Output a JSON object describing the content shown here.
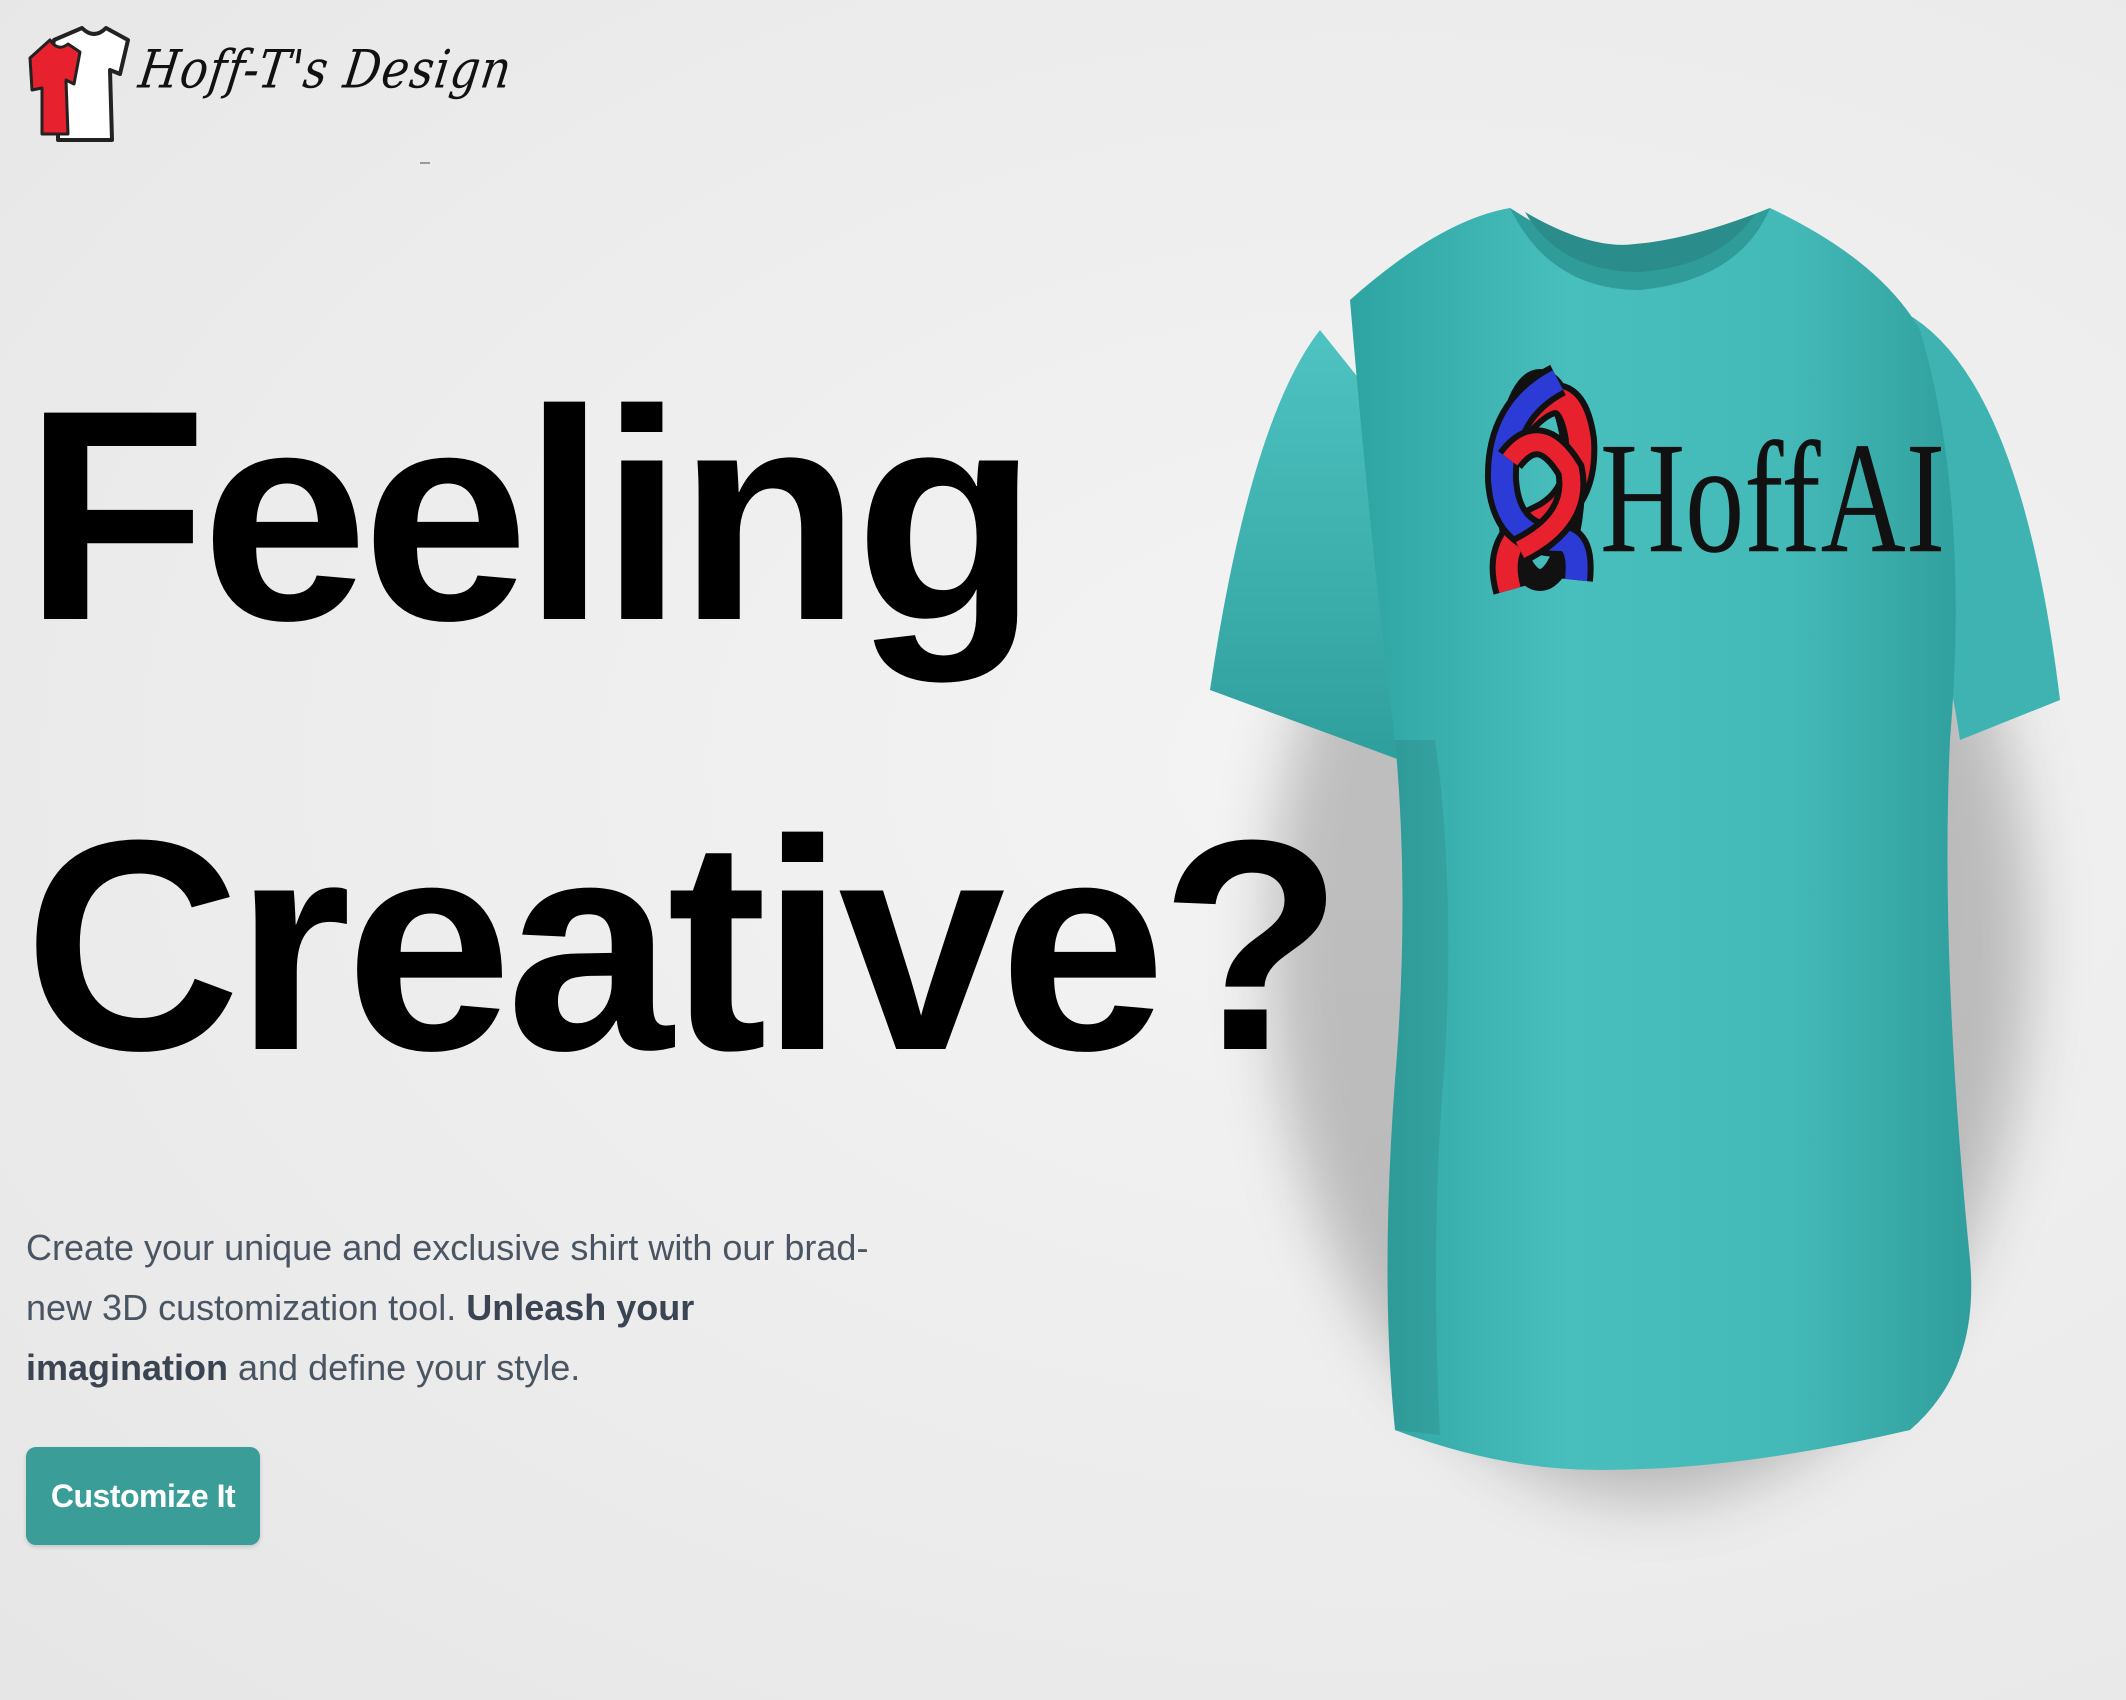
{
  "brand": {
    "name": "Hoff-T's Design",
    "logo_icon": "tshirt-icon"
  },
  "hero": {
    "headline_line1": "Feeling",
    "headline_line2": "Creative?",
    "description_part1": "Create your unique and exclusive shirt with our brad-new 3D customization tool. ",
    "description_bold": "Unleash your imagination",
    "description_part2": " and define your style.",
    "cta_label": "Customize It"
  },
  "shirt": {
    "color": "#48bfbd",
    "logo_text": "HoffAI",
    "logo_icon": "interlocked-knot-icon"
  },
  "colors": {
    "accent": "#3a9d98",
    "text_muted": "#4a5563",
    "logo_red": "#e8212e",
    "logo_blue": "#2c3ad6"
  }
}
